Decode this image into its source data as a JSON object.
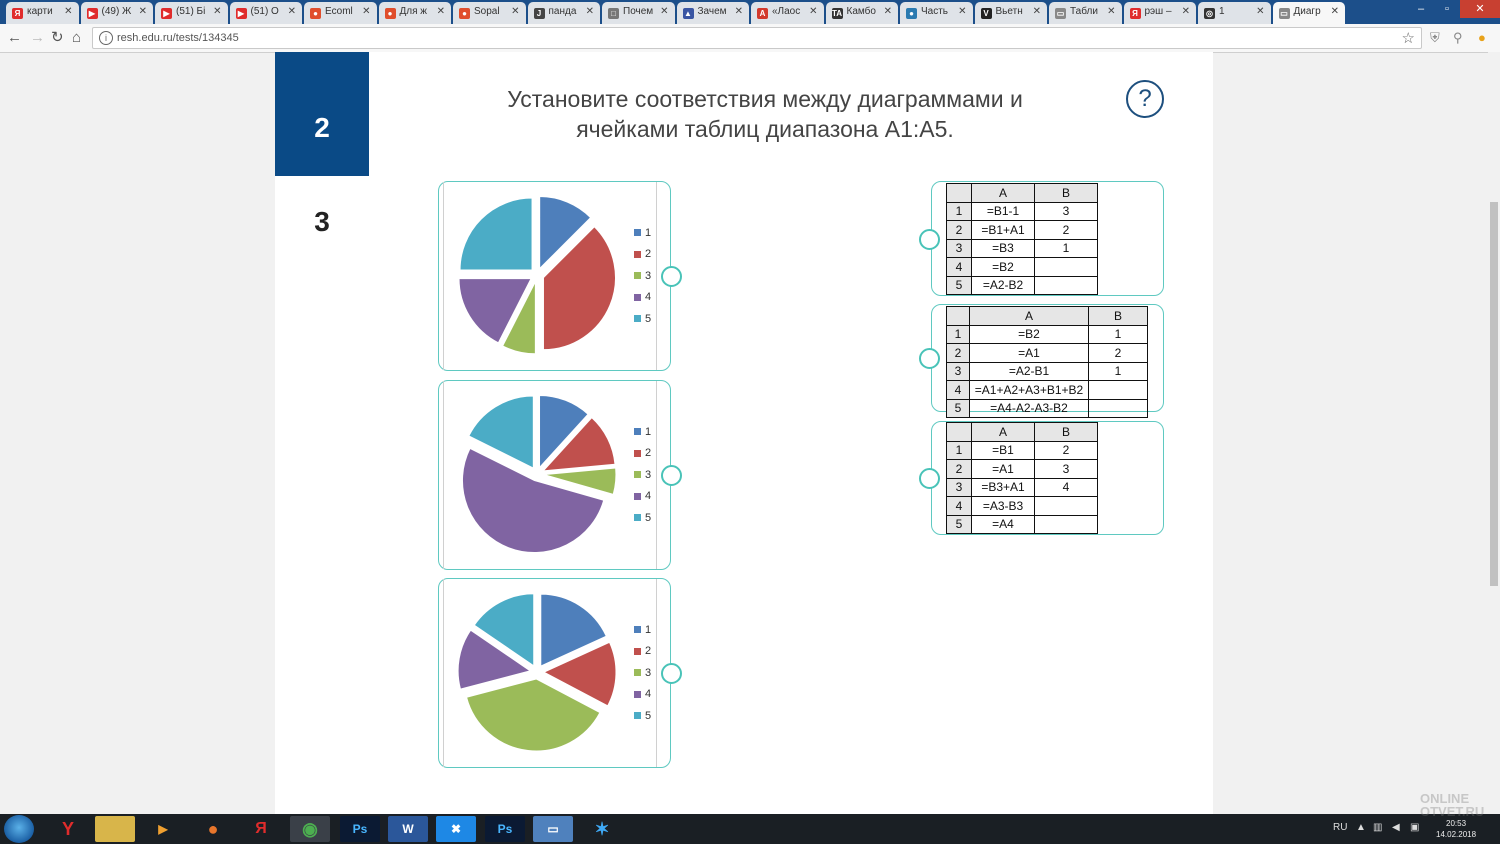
{
  "browser": {
    "tabs": [
      {
        "label": "карти",
        "fav": "Я",
        "color": "#e02c2c"
      },
      {
        "label": "(49) Ж",
        "fav": "▶",
        "color": "#e02c2c"
      },
      {
        "label": "(51) Бі",
        "fav": "▶",
        "color": "#e02c2c"
      },
      {
        "label": "(51) О",
        "fav": "▶",
        "color": "#e02c2c"
      },
      {
        "label": "Ecoml",
        "fav": "●",
        "color": "#e04e2c"
      },
      {
        "label": "Для ж",
        "fav": "●",
        "color": "#e04e2c"
      },
      {
        "label": "Sopal",
        "fav": "●",
        "color": "#e04e2c"
      },
      {
        "label": "панда",
        "fav": "J",
        "color": "#444444"
      },
      {
        "label": "Почем",
        "fav": "□",
        "color": "#777777"
      },
      {
        "label": "Зачем",
        "fav": "▲",
        "color": "#3955a3"
      },
      {
        "label": "«Лаос",
        "fav": "A",
        "color": "#d33a2c"
      },
      {
        "label": "Камбо",
        "fav": "TA",
        "color": "#333333"
      },
      {
        "label": "Часть",
        "fav": "●",
        "color": "#2a7ab0"
      },
      {
        "label": "Вьетн",
        "fav": "V",
        "color": "#222222"
      },
      {
        "label": "Табли",
        "fav": "▭",
        "color": "#888888"
      },
      {
        "label": "рэш –",
        "fav": "Я",
        "color": "#e02c2c"
      },
      {
        "label": "1",
        "fav": "◎",
        "color": "#333333"
      },
      {
        "label": "Диагр",
        "fav": "▭",
        "color": "#888888"
      }
    ],
    "url": "resh.edu.ru/tests/134345"
  },
  "question_nav": {
    "items": [
      {
        "label": "2",
        "active": true
      },
      {
        "label": "3",
        "active": false
      }
    ]
  },
  "question": {
    "title_line1": "Установите соответствия между диаграммами и",
    "title_line2": "ячейками таблиц диапазона A1:A5.",
    "help_symbol": "?"
  },
  "legend_labels": [
    "1",
    "2",
    "3",
    "4",
    "5"
  ],
  "pie_colors": [
    "#4e7fbb",
    "#c0504d",
    "#9bbb59",
    "#8064a2",
    "#4bacc6"
  ],
  "charts": [
    {
      "name": "chart-1",
      "values": [
        1,
        3,
        0.6,
        1.4,
        2
      ]
    },
    {
      "name": "chart-2",
      "values": [
        1,
        1,
        0.5,
        4.5,
        1.5
      ]
    },
    {
      "name": "chart-3",
      "values": [
        2,
        1.6,
        4.2,
        1.5,
        1.7
      ]
    }
  ],
  "tables": [
    {
      "headers": [
        "A",
        "B"
      ],
      "rows": [
        {
          "n": "1",
          "a": "=B1-1",
          "b": "3"
        },
        {
          "n": "2",
          "a": "=B1+A1",
          "b": "2"
        },
        {
          "n": "3",
          "a": "=B3",
          "b": "1"
        },
        {
          "n": "4",
          "a": "=B2",
          "b": ""
        },
        {
          "n": "5",
          "a": "=A2-B2",
          "b": ""
        }
      ]
    },
    {
      "headers": [
        "A",
        "B"
      ],
      "rows": [
        {
          "n": "1",
          "a": "=B2",
          "b": "1"
        },
        {
          "n": "2",
          "a": "=A1",
          "b": "2"
        },
        {
          "n": "3",
          "a": "=A2-B1",
          "b": "1"
        },
        {
          "n": "4",
          "a": "=A1+A2+A3+B1+B2",
          "b": ""
        },
        {
          "n": "5",
          "a": "=A4-A2-A3-B2",
          "b": ""
        }
      ]
    },
    {
      "headers": [
        "A",
        "B"
      ],
      "rows": [
        {
          "n": "1",
          "a": "=B1",
          "b": "2"
        },
        {
          "n": "2",
          "a": "=A1",
          "b": "3"
        },
        {
          "n": "3",
          "a": "=B3+A1",
          "b": "4"
        },
        {
          "n": "4",
          "a": "=A3-B3",
          "b": ""
        },
        {
          "n": "5",
          "a": "=A4",
          "b": ""
        }
      ]
    }
  ],
  "taskbar": {
    "lang": "RU",
    "time": "20:53",
    "date": "14.02.2018"
  },
  "watermark": {
    "line1": "ONLINE",
    "line2": "OTVET.RU"
  }
}
